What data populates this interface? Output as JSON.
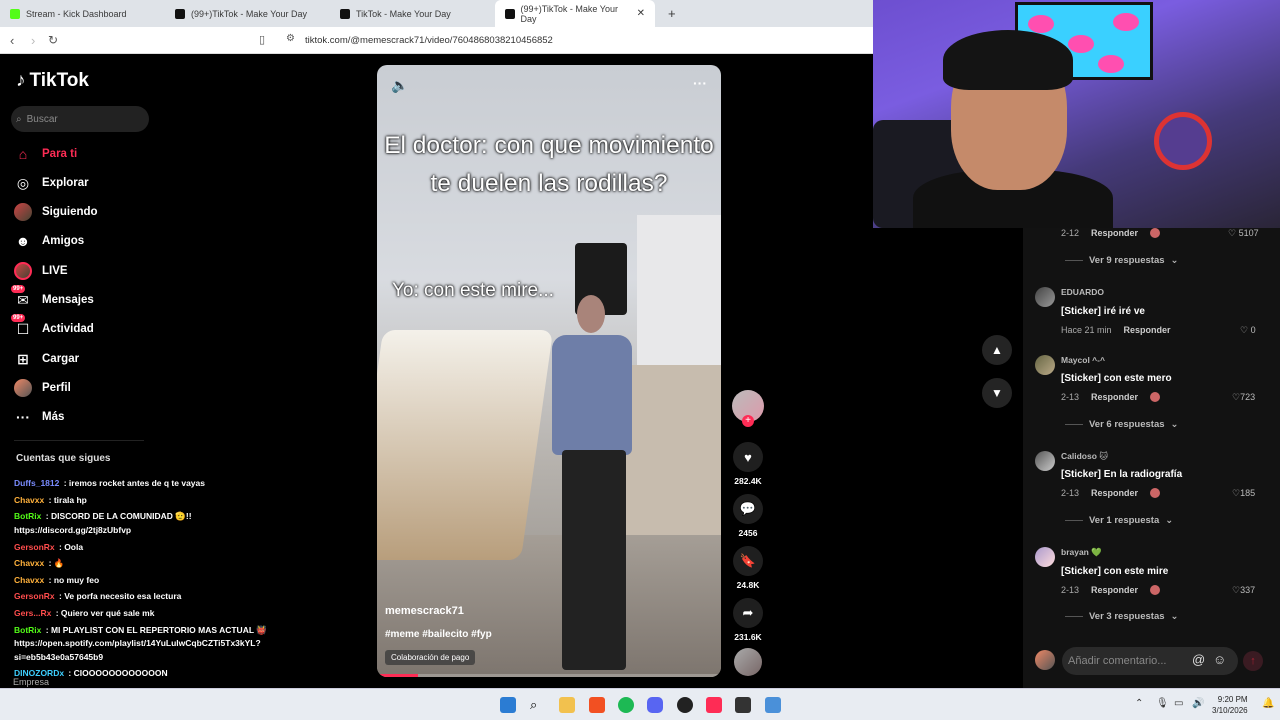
{
  "browser": {
    "tabs": [
      {
        "label": "Stream - Kick Dashboard",
        "icon": "kick-icon"
      },
      {
        "label": "(99+)TikTok - Make Your Day",
        "icon": "tiktok-icon"
      },
      {
        "label": "TikTok - Make Your Day",
        "icon": "tiktok-icon"
      },
      {
        "label": "(99+)TikTok - Make Your Day",
        "icon": "tiktok-icon"
      }
    ],
    "new_tab": "+",
    "url": "tiktok.com/@memescrack71/video/7604868038210456852"
  },
  "sidebar": {
    "logo": "TikTok",
    "search_placeholder": "Buscar",
    "items": [
      {
        "label": "Para ti",
        "icon": "home-icon",
        "glyph": "⌂"
      },
      {
        "label": "Explorar",
        "icon": "compass-icon",
        "glyph": "◎"
      },
      {
        "label": "Siguiendo",
        "icon": "following-avatar-icon",
        "glyph": ""
      },
      {
        "label": "Amigos",
        "icon": "friends-icon",
        "glyph": "☻"
      },
      {
        "label": "LIVE",
        "icon": "live-avatar-icon",
        "glyph": ""
      },
      {
        "label": "Mensajes",
        "icon": "messages-icon",
        "glyph": "✉",
        "badge": "99+"
      },
      {
        "label": "Actividad",
        "icon": "activity-icon",
        "glyph": "☐",
        "badge": "99+"
      },
      {
        "label": "Cargar",
        "icon": "upload-icon",
        "glyph": "⊞"
      },
      {
        "label": "Perfil",
        "icon": "profile-avatar-icon",
        "glyph": ""
      },
      {
        "label": "Más",
        "icon": "more-icon",
        "glyph": "···"
      }
    ],
    "following_title": "Cuentas que sigues",
    "footer": "Empresa"
  },
  "chat": [
    {
      "user": "Duffs_1812",
      "sep": " : ",
      "text": "iremos rocket antes de q te vayas",
      "color": "#7a8cff"
    },
    {
      "user": "Chavxx",
      "sep": " : ",
      "text": "tirala hp",
      "color": "#ffb13b"
    },
    {
      "user": "BotRix",
      "sep": " : ",
      "text": "DISCORD DE LA COMUNIDAD 🫡!!",
      "color": "#53fc18"
    },
    {
      "user": "",
      "sep": "",
      "text": "https://discord.gg/2tj8zUbfvp",
      "color": "#fff"
    },
    {
      "user": "GersonRx",
      "sep": " : ",
      "text": "Oola",
      "color": "#ff4d4d"
    },
    {
      "user": "Chavxx",
      "sep": " : ",
      "text": "🔥",
      "color": "#ffb13b"
    },
    {
      "user": "Chavxx",
      "sep": " : ",
      "text": "no muy feo",
      "color": "#ffb13b"
    },
    {
      "user": "GersonRx",
      "sep": " : ",
      "text": "Ve porfa necesito esa lectura",
      "color": "#ff4d4d"
    },
    {
      "user": "Gers...Rx",
      "sep": " : ",
      "text": "Quiero ver qué sale mk",
      "color": "#ff4d4d"
    },
    {
      "user": "BotRix",
      "sep": " : ",
      "text": "MI PLAYLIST CON EL REPERTORIO MAS ACTUAL 👹",
      "color": "#53fc18"
    },
    {
      "user": "",
      "sep": "",
      "text": "https://open.spotify.com/playlist/14YuLulwCqbCZTi5Tx3kYL?",
      "color": "#fff"
    },
    {
      "user": "",
      "sep": "",
      "text": "si=eb5b43e0a57645b9",
      "color": "#fff"
    },
    {
      "user": "DINOZORDx",
      "sep": " : ",
      "text": "CIOOOOOOOOOOOON",
      "color": "#3ed0ff"
    }
  ],
  "video": {
    "overlay_title": "El doctor: con que movimiento te duelen las rodillas?",
    "overlay_sub": "Yo: con este mire...",
    "author": "memescrack71",
    "tags": "#meme #bailecito #fyp",
    "collab": "Colaboración de pago",
    "progress": 0.12
  },
  "actions": {
    "likes": "282.4K",
    "comments": "2456",
    "saves": "24.8K",
    "shares": "231.6K"
  },
  "comments": {
    "top": {
      "date": "2-12",
      "reply": "Responder",
      "likes": "5107",
      "replies": "Ver 9 respuestas"
    },
    "items": [
      {
        "user": "EDUARDO",
        "text": "[Sticker] iré iré ve",
        "date": "Hace 21 min",
        "reply": "Responder",
        "likes": "0",
        "replies": ""
      },
      {
        "user": "Maycol ^-^",
        "text": "[Sticker] con este mero",
        "date": "2-13",
        "reply": "Responder",
        "likes": "723",
        "replies": "Ver 6 respuestas"
      },
      {
        "user": "Calidoso 🐱",
        "text": "[Sticker] En la radiografía",
        "date": "2-13",
        "reply": "Responder",
        "likes": "185",
        "replies": "Ver 1 respuesta"
      },
      {
        "user": "brayan 💚",
        "text": "[Sticker] con este mire",
        "date": "2-13",
        "reply": "Responder",
        "likes": "337",
        "replies": "Ver 3 respuestas"
      }
    ],
    "input_placeholder": "Añadir comentario..."
  },
  "taskbar": {
    "time": "9:20 PM",
    "date": "3/10/2026"
  }
}
